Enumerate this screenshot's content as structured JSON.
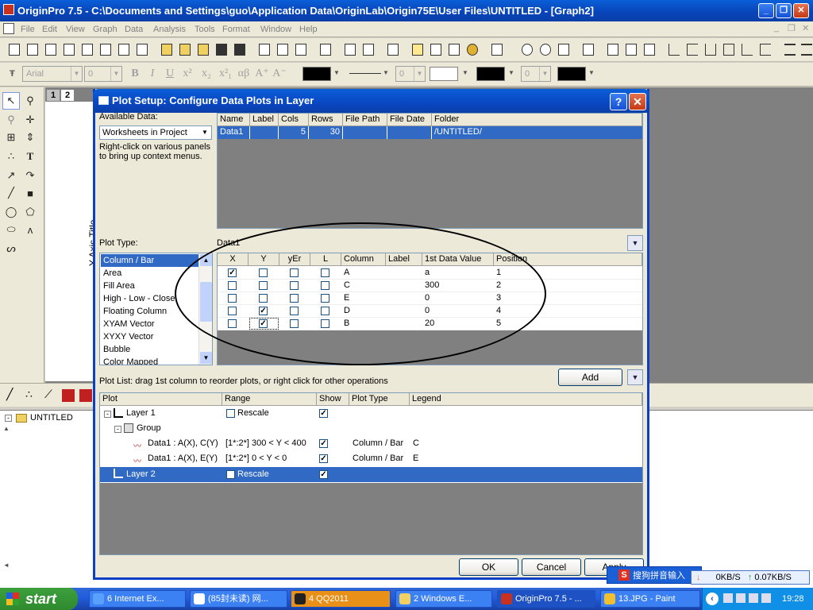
{
  "app": {
    "title": "OriginPro 7.5 - C:\\Documents and Settings\\guo\\Application Data\\OriginLab\\Origin75E\\User Files\\UNTITLED - [Graph2]",
    "window_buttons": [
      "_",
      "❐",
      "✕"
    ]
  },
  "menu": [
    "File",
    "Edit",
    "View",
    "Graph",
    "Data",
    "Analysis",
    "Tools",
    "Format",
    "Window",
    "Help"
  ],
  "format_toolbar": {
    "font": "Arial",
    "size": "0",
    "bold": "B",
    "italic": "I",
    "underline": "U",
    "superscript": "x²",
    "subscript": "x₂",
    "supsub": "x²₁",
    "greek": "αβ",
    "larger": "A⁺",
    "smaller": "A⁻",
    "line_width": "0",
    "pattern_width": "0"
  },
  "layer_tabs": [
    "1",
    "2"
  ],
  "graph": {
    "y_axis_title": "Y Axis Title"
  },
  "project": {
    "folder": "UNTITLED"
  },
  "dialog": {
    "title": "Plot Setup: Configure Data Plots in Layer",
    "help": "?",
    "close": "✕",
    "available_data_label": "Available Data:",
    "available_data_value": "Worksheets in Project",
    "hint": "Right-click on various panels to bring up context menus.",
    "datasets_columns": [
      "Name",
      "Label",
      "Cols",
      "Rows",
      "File Path",
      "File Date",
      "Folder"
    ],
    "datasets": [
      {
        "name": "Data1",
        "label": "",
        "cols": "5",
        "rows": "30",
        "file_path": "",
        "file_date": "",
        "folder": "/UNTITLED/"
      }
    ],
    "plot_type_label": "Plot Type:",
    "current_dataset": "Data1",
    "plot_types": [
      "Column / Bar",
      "Area",
      "Fill Area",
      "High - Low - Close",
      "Floating Column",
      "XYAM Vector",
      "XYXY Vector",
      "Bubble",
      "Color Mapped"
    ],
    "column_headers": [
      "X",
      "Y",
      "yEr",
      "L",
      "Column",
      "Label",
      "1st Data Value",
      "Position"
    ],
    "columns": [
      {
        "x": true,
        "y": false,
        "yer": false,
        "l": false,
        "column": "A",
        "label": "",
        "first": "a",
        "position": "1"
      },
      {
        "x": false,
        "y": false,
        "yer": false,
        "l": false,
        "column": "C",
        "label": "",
        "first": "300",
        "position": "2"
      },
      {
        "x": false,
        "y": false,
        "yer": false,
        "l": false,
        "column": "E",
        "label": "",
        "first": "0",
        "position": "3"
      },
      {
        "x": false,
        "y": true,
        "yer": false,
        "l": false,
        "column": "D",
        "label": "",
        "first": "0",
        "position": "4"
      },
      {
        "x": false,
        "y": true,
        "yer": false,
        "l": false,
        "column": "B",
        "label": "",
        "first": "20",
        "position": "5"
      }
    ],
    "plot_list_hint": "Plot List: drag 1st column to reorder plots, or right click for other operations",
    "add_button": "Add",
    "plot_list_headers": [
      "Plot",
      "Range",
      "Show",
      "Plot Type",
      "Legend"
    ],
    "plot_list": {
      "layer1": "Layer 1",
      "layer1_range": "Rescale",
      "group": "Group",
      "plot1": {
        "name": "Data1 : A(X), C(Y)",
        "range": "[1*:2*]  300 < Y < 400",
        "type": "Column / Bar",
        "legend": "C"
      },
      "plot2": {
        "name": "Data1 : A(X), E(Y)",
        "range": "[1*:2*]  0 < Y < 0",
        "type": "Column / Bar",
        "legend": "E"
      },
      "layer2": "Layer 2",
      "layer2_range": "Rescale"
    },
    "ok": "OK",
    "cancel": "Cancel",
    "apply": "Apply"
  },
  "taskbar": {
    "start": "start",
    "tasks": [
      "6 Internet Ex...",
      "(85封未读) 网...",
      "4 QQ2011",
      "2 Windows E...",
      "OriginPro 7.5 - ...",
      "13.JPG - Paint"
    ],
    "clock": "19:28",
    "ime": "搜狗拼音输入",
    "net_down": "0KB/S",
    "net_up": "0.07KB/S"
  },
  "colors": {
    "selection": "#316ac5",
    "title_bar": "#0a46c2",
    "gray_panel": "#808080"
  }
}
